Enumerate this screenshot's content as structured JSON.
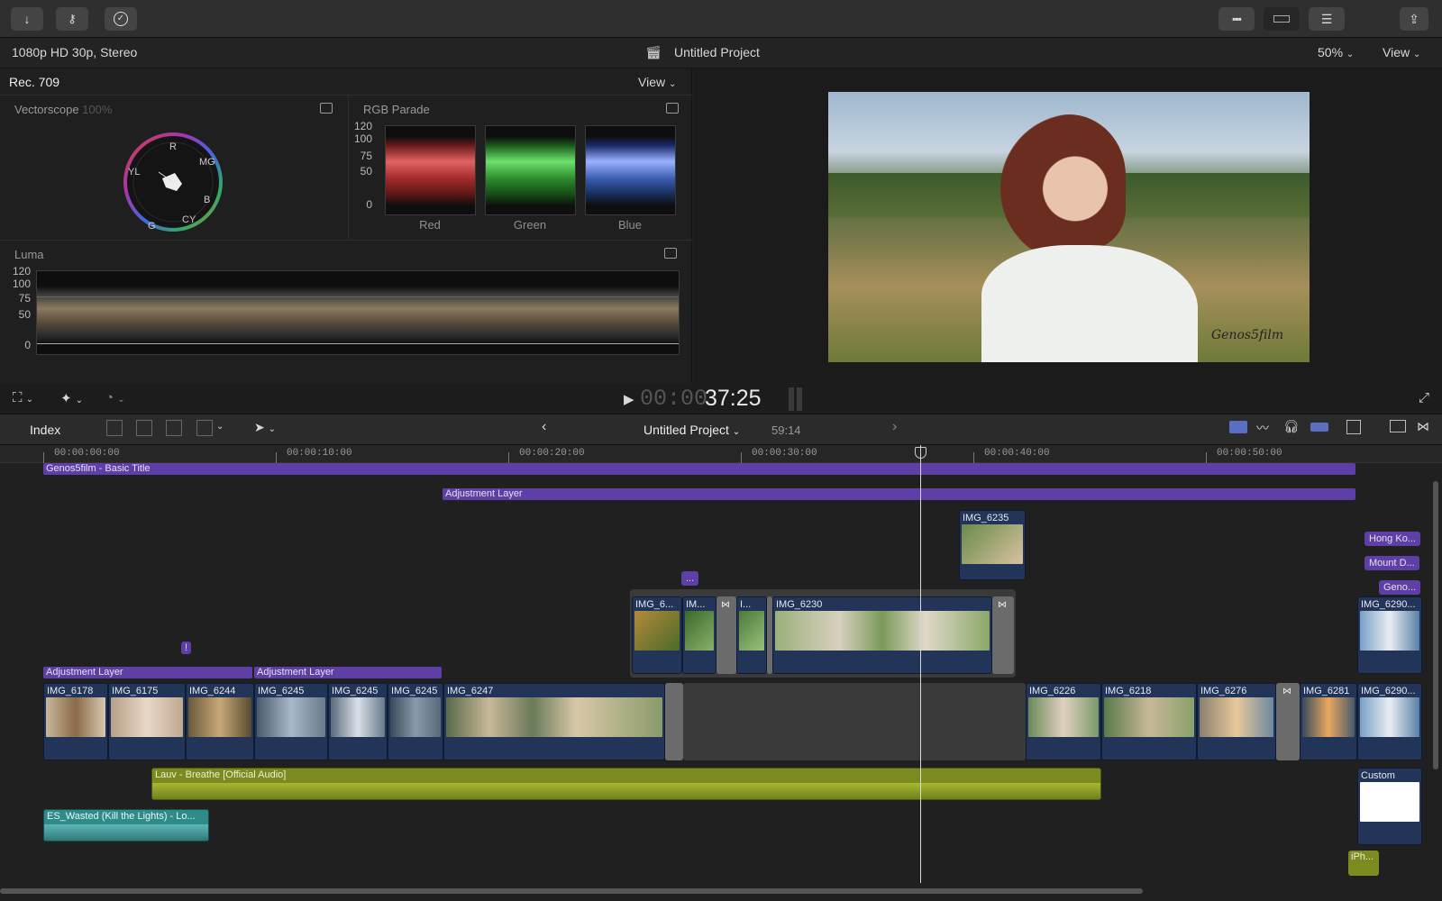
{
  "toolbar": {
    "left_icons": [
      "import-icon",
      "keywords-icon",
      "background-tasks-icon"
    ],
    "right_icons": [
      "browser-layout-icon",
      "timeline-layout-icon",
      "inspector-icon",
      "share-icon"
    ]
  },
  "viewer_bar": {
    "format": "1080p HD 30p, Stereo",
    "project_title": "Untitled Project",
    "zoom": "50%",
    "view_label": "View"
  },
  "scopes": {
    "colorspace": "Rec. 709",
    "view_label": "View",
    "vectorscope": {
      "title": "Vectorscope",
      "percent": "100%",
      "labels": [
        "R",
        "MG",
        "B",
        "CY",
        "G",
        "YL"
      ]
    },
    "parade": {
      "title": "RGB Parade",
      "ticks": [
        "120",
        "100",
        "75",
        "50",
        "0"
      ],
      "channels": [
        "Red",
        "Green",
        "Blue"
      ]
    },
    "luma": {
      "title": "Luma",
      "ticks": [
        "120",
        "100",
        "75",
        "50",
        "0"
      ]
    }
  },
  "viewer": {
    "watermark": "Genos5film"
  },
  "transport": {
    "timecode_dim": "00:00",
    "timecode": "37:25"
  },
  "timeline_header": {
    "index_label": "Index",
    "project_title": "Untitled Project",
    "duration": "59:14"
  },
  "ruler": {
    "labels": [
      "00:00:00:00",
      "00:00:10:00",
      "00:00:20:00",
      "00:00:30:00",
      "00:00:40:00",
      "00:00:50:00"
    ]
  },
  "bars": {
    "title": "Genos5film - Basic Title",
    "adjustment_top": "Adjustment Layer",
    "adjustment_a": "Adjustment Layer",
    "adjustment_b": "Adjustment Layer",
    "dots_tag": "...",
    "marker_tag": "!"
  },
  "side_tags": [
    "Hong Ko...",
    "Mount D...",
    "Geno..."
  ],
  "connected_clips": {
    "img6235": "IMG_6235",
    "storyline": [
      "IMG_6...",
      "IM...",
      "I...",
      "IMG_6230"
    ],
    "right": "IMG_6290..."
  },
  "primary_clips": [
    "IMG_6178",
    "IMG_6175",
    "IMG_6244",
    "IMG_6245",
    "IMG_6245",
    "IMG_6245",
    "IMG_6247",
    "IMG_6226",
    "IMG_6218",
    "IMG_6276",
    "IMG_6281",
    "IMG_6290..."
  ],
  "audio": {
    "music": "Lauv - Breathe [Official Audio]",
    "sfx": "ES_Wasted (Kill the Lights) - Lo...",
    "custom": "Custom",
    "iphone": "iPh..."
  },
  "colors": {
    "title_purple": "#5e3fa6",
    "clip_blue": "#223559",
    "audio_olive": "#7c8a1f",
    "audio_teal": "#2f8a8a"
  }
}
